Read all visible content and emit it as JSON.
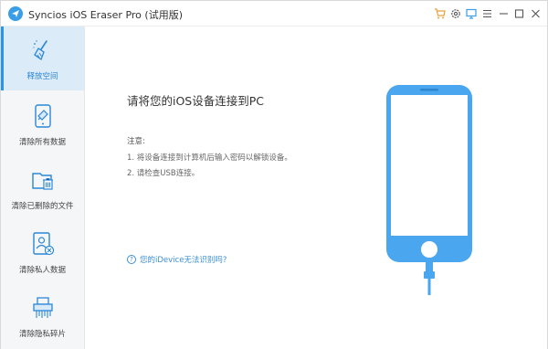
{
  "titlebar": {
    "title": "Syncios iOS Eraser Pro (试用版)",
    "buttons": [
      "cart-icon",
      "settings-icon",
      "feedback-icon",
      "menu-icon",
      "minimize-icon",
      "maximize-icon",
      "close-icon"
    ]
  },
  "sidebar": {
    "items": [
      {
        "label": "释放空间",
        "icon": "broom-icon",
        "active": true
      },
      {
        "label": "清除所有数据",
        "icon": "phone-erase-icon",
        "active": false
      },
      {
        "label": "清除已删除的文件",
        "icon": "folder-delete-icon",
        "active": false
      },
      {
        "label": "清除私人数据",
        "icon": "private-data-icon",
        "active": false
      },
      {
        "label": "清除隐私碎片",
        "icon": "shredder-icon",
        "active": false
      }
    ]
  },
  "main": {
    "headline": "请将您的iOS设备连接到PC",
    "note_title": "注意:",
    "notes": [
      "1. 将设备连接到计算机后输入密码以解锁设备。",
      "2. 请检查USB连接。"
    ],
    "help_link": "您的iDevice无法识别吗?",
    "help_icon": "question-icon",
    "illustration": "phone-with-cable"
  },
  "colors": {
    "accent": "#3a9de8",
    "sidebar_bg": "#f4f6f8",
    "active_bg": "#dcebf8"
  }
}
